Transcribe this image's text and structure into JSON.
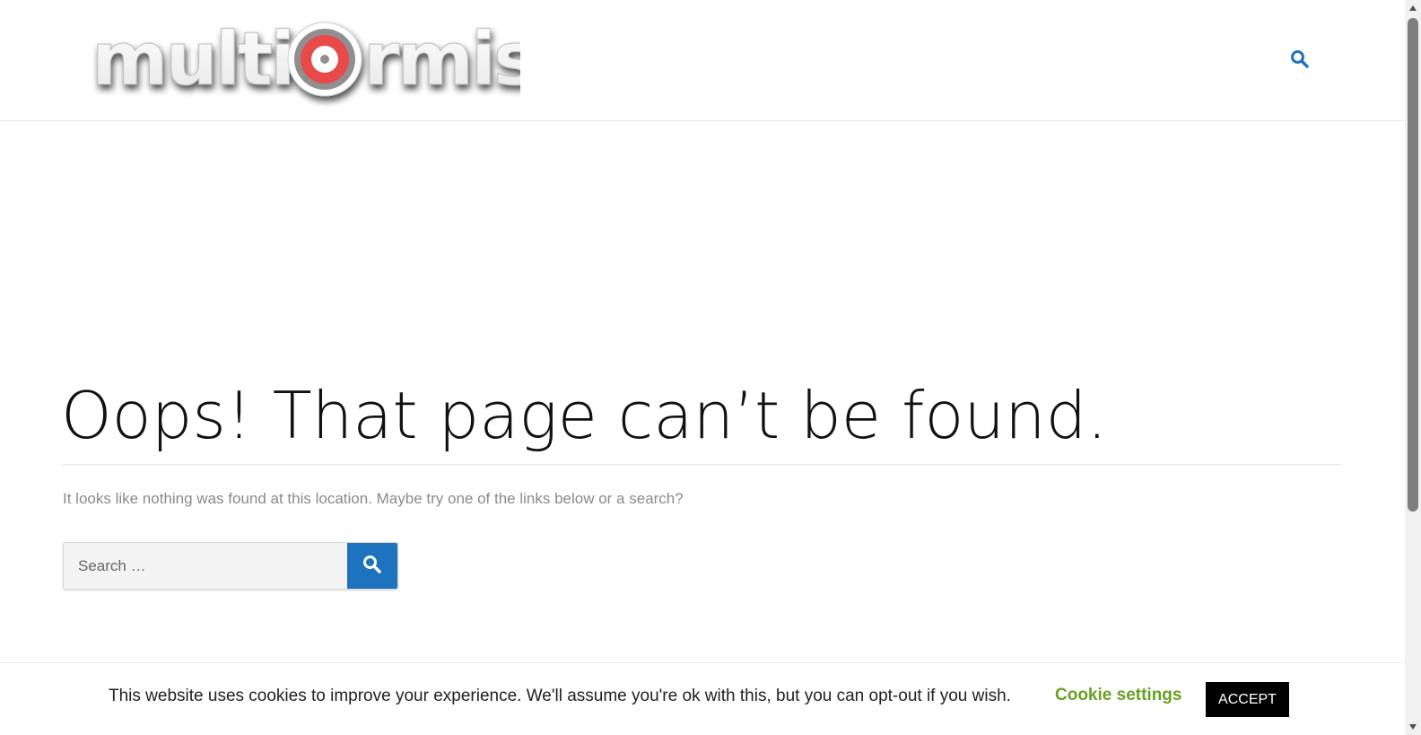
{
  "header": {
    "logo_text": "multiformis",
    "search_icon": "search-icon"
  },
  "main": {
    "title": "Oops! That page can’t be found.",
    "message": "It looks like nothing was found at this location. Maybe try one of the links below or a search?",
    "search": {
      "placeholder": "Search …",
      "value": "",
      "submit_icon": "search-icon"
    }
  },
  "cookie_bar": {
    "text": "This website uses cookies to improve your experience. We'll assume you're ok with this, but you can opt-out if you wish.",
    "settings_label": "Cookie settings",
    "accept_label": "ACCEPT"
  },
  "colors": {
    "accent_blue": "#1e73be",
    "cookie_settings_green": "#6aa022",
    "logo_red": "#e84848",
    "title_text": "#111111",
    "muted_text": "#8a8a8a"
  }
}
